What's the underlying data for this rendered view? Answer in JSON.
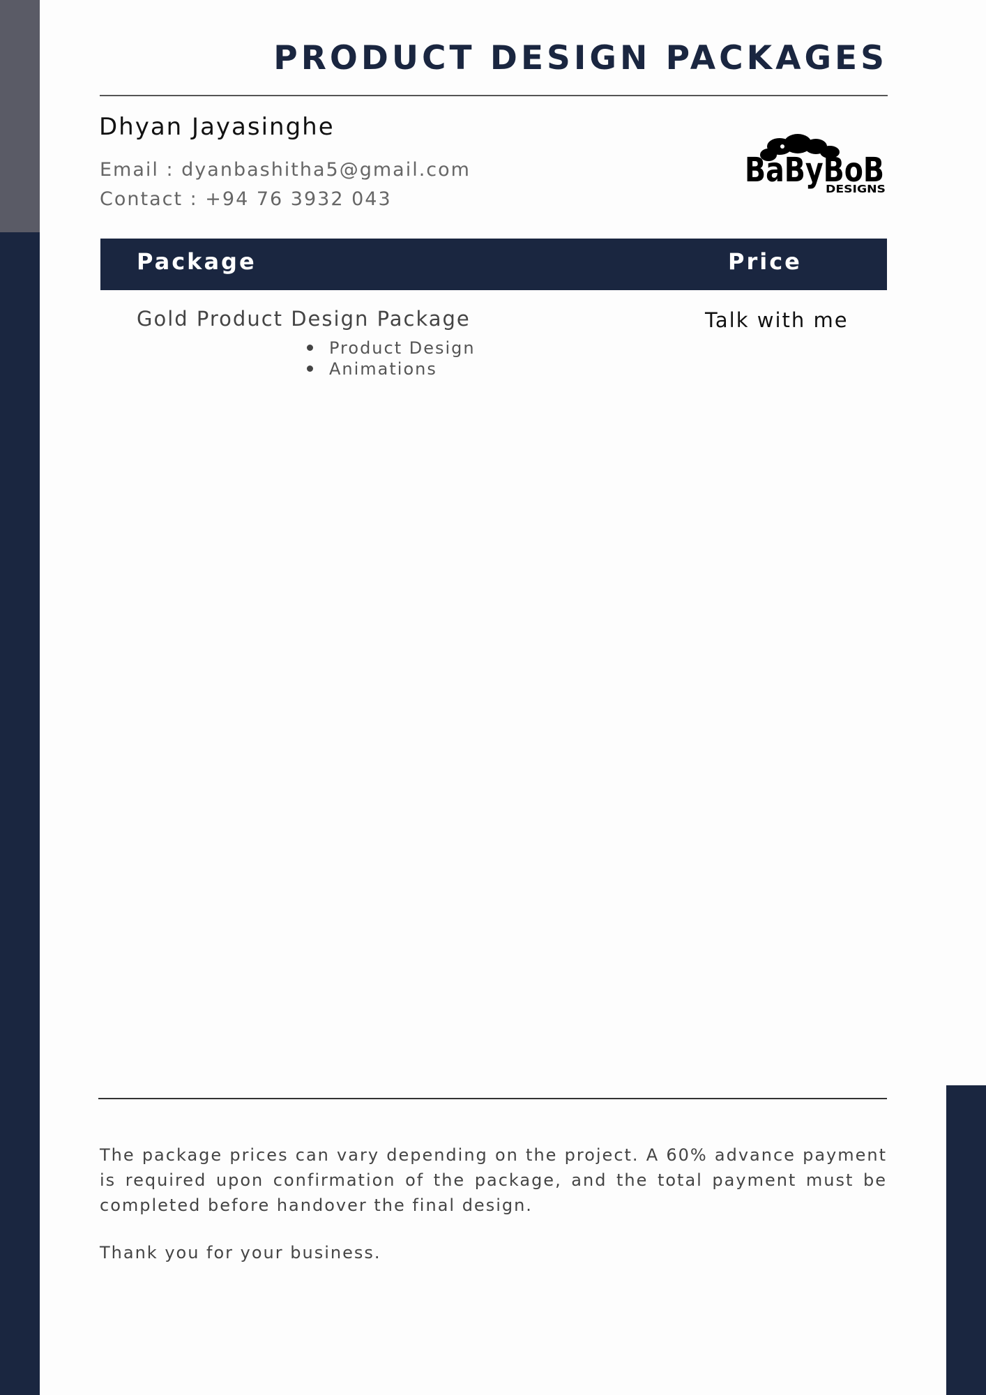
{
  "header": {
    "title": "PRODUCT DESIGN PACKAGES"
  },
  "contact": {
    "name": "Dhyan Jayasinghe",
    "email_line": "Email : dyanbashitha5@gmail.com",
    "phone_line": "Contact : +94 76 3932 043"
  },
  "logo": {
    "text_main": "BaByBoB",
    "text_sub": "DESIGNS"
  },
  "table": {
    "headers": [
      "Package",
      "Price"
    ],
    "rows": [
      {
        "package": "Gold Product Design Package",
        "price": "Talk with me",
        "features": [
          "Product Design",
          "Animations"
        ]
      }
    ]
  },
  "footer": {
    "notes": "The package prices can vary depending on the project. A 60% advance payment is required upon confirmation of the package, and the total payment must be completed before handover the final design.",
    "thanks": "Thank you for your business."
  },
  "colors": {
    "navy": "#1a2640",
    "gray_band": "#5a5b66"
  }
}
